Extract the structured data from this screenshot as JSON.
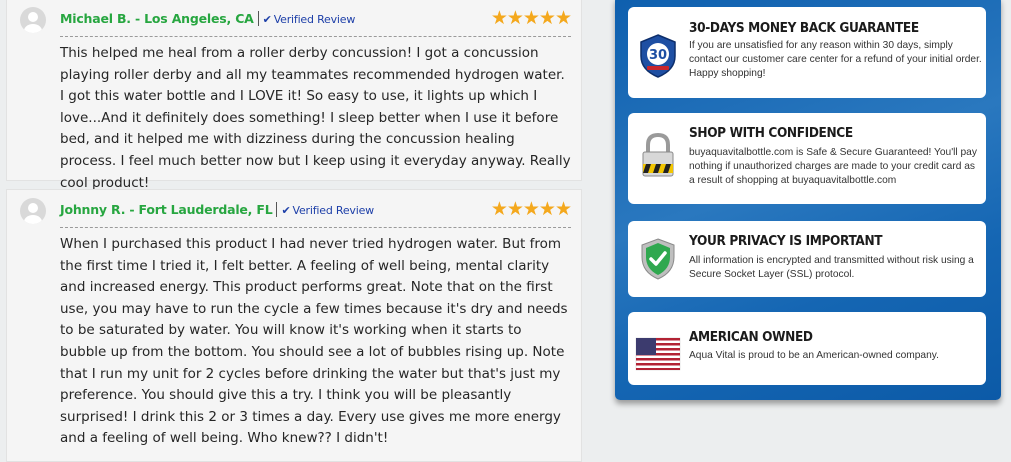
{
  "reviews": [
    {
      "author": "Michael B. - Los Angeles, CA",
      "verified": "Verified Review",
      "stars": "★★★★★",
      "body": "This helped me heal from a roller derby concussion! I got a concussion playing roller derby and all my teammates recommended hydrogen water. I got this water bottle and I LOVE it! So easy to use, it lights up which I love...And it definitely does something! I sleep better when I use it before bed, and it helped me with dizziness during the concussion healing process. I feel much better now but I keep using it everyday anyway. Really cool product!"
    },
    {
      "author": "Johnny R. - Fort Lauderdale, FL",
      "verified": "Verified Review",
      "stars": "★★★★★",
      "body": "When I purchased this product I had never tried hydrogen water. But from the first time I tried it, I felt better. A feeling of well being, mental clarity and increased energy. This product performs great. Note that on the first use, you may have to run the cycle a few times because it's dry and needs to be saturated by water. You will know it's working when it starts to bubble up from the bottom. You should see a lot of bubbles rising up. Note that I run my unit for 2 cycles before drinking the water but that's just my preference. You should give this a try. I think you will be pleasantly surprised! I drink this 2 or 3 times a day. Every use gives me more energy and a feeling of well being. Who knew?? I didn't!"
    }
  ],
  "guarantees": [
    {
      "title": "30-DAYS MONEY BACK GUARANTEE",
      "text": "If you are unsatisfied for any reason within 30 days, simply contact our customer care center for a refund of your initial order. Happy shopping!",
      "icon": "30-day-badge-icon",
      "badge_text": "30"
    },
    {
      "title": "SHOP WITH CONFIDENCE",
      "text": "buyaquavitalbottle.com is Safe & Secure Guaranteed! You'll pay nothing if unauthorized charges are made to your credit card as a result of shopping at buyaquavitalbottle.com",
      "icon": "padlock-icon"
    },
    {
      "title": "YOUR PRIVACY IS IMPORTANT",
      "text": "All information is encrypted and transmitted without risk using a Secure Socket Layer (SSL) protocol.",
      "icon": "shield-check-icon"
    },
    {
      "title": "AMERICAN OWNED",
      "text": "Aqua Vital is proud to be an American-owned company.",
      "icon": "us-flag-icon"
    }
  ],
  "colors": {
    "author_green": "#27a640",
    "verified_blue": "#1d3fa8",
    "star_orange": "#f4a81d",
    "panel_blue": "#1566b3"
  }
}
